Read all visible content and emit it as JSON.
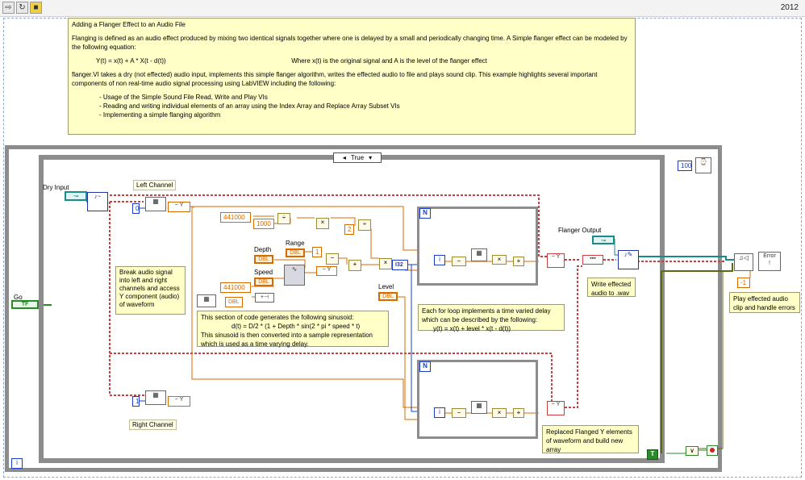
{
  "toolbar": {
    "year": "2012"
  },
  "header_note": {
    "title": "Adding a Flanger Effect to an Audio File",
    "p1": "Flanging is defined as an audio effect produced by mixing two identical signals together where one is delayed by a small and periodically changing time. A Simple flanger effect can be modeled by the following equation:",
    "eq": "Y(t) = x(t) + A * X(t - d(t))",
    "eq_note": "Where x(t) is the original signal and A is the level of the flanger effect",
    "p2": "flanger.VI takes a dry (not effected) audio input, implements this simple flanger  algorithm, writes the effected audio to file and plays sound clip. This example highlights several important components of non real-time audio signal processing using LabVIEW including the following:",
    "b1": "- Usage of the Simple Sound File Read, Write and Play VIs",
    "b2": "- Reading and writing individual elements of an array using the Index Array and Replace Array Subset VIs",
    "b3": "- Implementing a simple flanging algorithm"
  },
  "case": {
    "selector": "True"
  },
  "labels": {
    "dry_input": "Dry Input",
    "left_channel": "Left Channel",
    "right_channel": "Right Channel",
    "go": "Go",
    "depth": "Depth",
    "range": "Range",
    "speed": "Speed",
    "level": "Level",
    "flanger_output": "Flanger Output"
  },
  "consts": {
    "c0": "0",
    "c1": "1",
    "rate1": "441000",
    "rate2": "441000",
    "k1000": "1000",
    "k2": "2",
    "wait": "100",
    "neg1": "-1",
    "dbl": "DBL",
    "i32": "I32",
    "tf": "TF",
    "y": "Y",
    "n": "N",
    "i": "i"
  },
  "notes": {
    "break": "Break audio signal into left and right channels and access Y component (audio) of waveform",
    "sinusoid_a": "This section of code generates the following sinusoid:",
    "sinusoid_eq": "d(t) = D/2 * (1 + Depth * sin(2 * pi * speed * t)",
    "sinusoid_b": "This sinusoid is then converted into a sample representation which is used as a time varying delay.",
    "loop_a": "Each for loop implements a time varied delay which can be described by the following:",
    "loop_eq": "y(t) = x(t) + level * x(t - d(t))",
    "write": "Write effected audio to .wav",
    "replace": "Replaced Flanged Y elements of waveform and build new array",
    "play": "Play effected audio clip and handle errors"
  },
  "colors": {
    "note_bg": "#ffffc8",
    "orange": "#d86a00",
    "blue": "#1a3cc8",
    "pink": "#c84040",
    "green": "#2a8a2a",
    "teal": "#1a8a8a"
  }
}
